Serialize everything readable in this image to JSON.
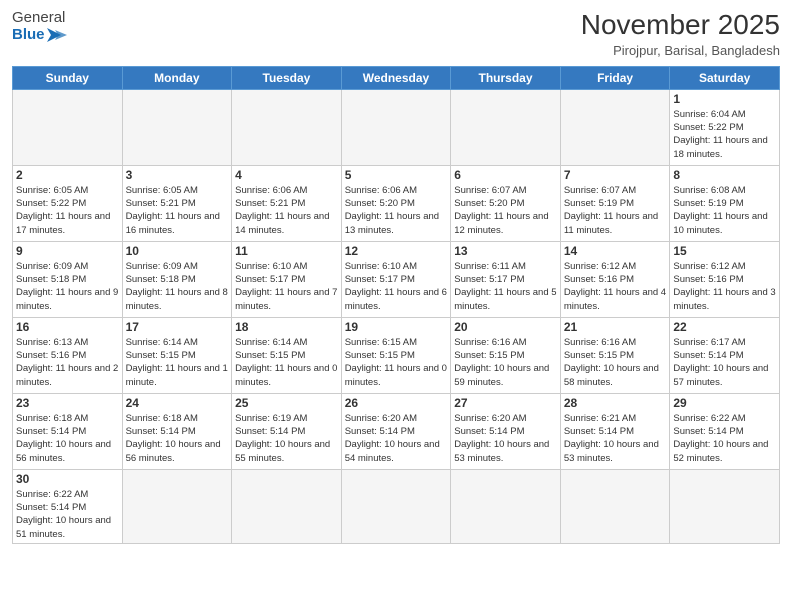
{
  "header": {
    "logo_general": "General",
    "logo_blue": "Blue",
    "month_title": "November 2025",
    "location": "Pirojpur, Barisal, Bangladesh"
  },
  "weekdays": [
    "Sunday",
    "Monday",
    "Tuesday",
    "Wednesday",
    "Thursday",
    "Friday",
    "Saturday"
  ],
  "days": [
    {
      "num": "",
      "info": ""
    },
    {
      "num": "",
      "info": ""
    },
    {
      "num": "",
      "info": ""
    },
    {
      "num": "",
      "info": ""
    },
    {
      "num": "",
      "info": ""
    },
    {
      "num": "",
      "info": ""
    },
    {
      "num": "1",
      "info": "Sunrise: 6:04 AM\nSunset: 5:22 PM\nDaylight: 11 hours and 18 minutes."
    },
    {
      "num": "2",
      "info": "Sunrise: 6:05 AM\nSunset: 5:22 PM\nDaylight: 11 hours and 17 minutes."
    },
    {
      "num": "3",
      "info": "Sunrise: 6:05 AM\nSunset: 5:21 PM\nDaylight: 11 hours and 16 minutes."
    },
    {
      "num": "4",
      "info": "Sunrise: 6:06 AM\nSunset: 5:21 PM\nDaylight: 11 hours and 14 minutes."
    },
    {
      "num": "5",
      "info": "Sunrise: 6:06 AM\nSunset: 5:20 PM\nDaylight: 11 hours and 13 minutes."
    },
    {
      "num": "6",
      "info": "Sunrise: 6:07 AM\nSunset: 5:20 PM\nDaylight: 11 hours and 12 minutes."
    },
    {
      "num": "7",
      "info": "Sunrise: 6:07 AM\nSunset: 5:19 PM\nDaylight: 11 hours and 11 minutes."
    },
    {
      "num": "8",
      "info": "Sunrise: 6:08 AM\nSunset: 5:19 PM\nDaylight: 11 hours and 10 minutes."
    },
    {
      "num": "9",
      "info": "Sunrise: 6:09 AM\nSunset: 5:18 PM\nDaylight: 11 hours and 9 minutes."
    },
    {
      "num": "10",
      "info": "Sunrise: 6:09 AM\nSunset: 5:18 PM\nDaylight: 11 hours and 8 minutes."
    },
    {
      "num": "11",
      "info": "Sunrise: 6:10 AM\nSunset: 5:17 PM\nDaylight: 11 hours and 7 minutes."
    },
    {
      "num": "12",
      "info": "Sunrise: 6:10 AM\nSunset: 5:17 PM\nDaylight: 11 hours and 6 minutes."
    },
    {
      "num": "13",
      "info": "Sunrise: 6:11 AM\nSunset: 5:17 PM\nDaylight: 11 hours and 5 minutes."
    },
    {
      "num": "14",
      "info": "Sunrise: 6:12 AM\nSunset: 5:16 PM\nDaylight: 11 hours and 4 minutes."
    },
    {
      "num": "15",
      "info": "Sunrise: 6:12 AM\nSunset: 5:16 PM\nDaylight: 11 hours and 3 minutes."
    },
    {
      "num": "16",
      "info": "Sunrise: 6:13 AM\nSunset: 5:16 PM\nDaylight: 11 hours and 2 minutes."
    },
    {
      "num": "17",
      "info": "Sunrise: 6:14 AM\nSunset: 5:15 PM\nDaylight: 11 hours and 1 minute."
    },
    {
      "num": "18",
      "info": "Sunrise: 6:14 AM\nSunset: 5:15 PM\nDaylight: 11 hours and 0 minutes."
    },
    {
      "num": "19",
      "info": "Sunrise: 6:15 AM\nSunset: 5:15 PM\nDaylight: 11 hours and 0 minutes."
    },
    {
      "num": "20",
      "info": "Sunrise: 6:16 AM\nSunset: 5:15 PM\nDaylight: 10 hours and 59 minutes."
    },
    {
      "num": "21",
      "info": "Sunrise: 6:16 AM\nSunset: 5:15 PM\nDaylight: 10 hours and 58 minutes."
    },
    {
      "num": "22",
      "info": "Sunrise: 6:17 AM\nSunset: 5:14 PM\nDaylight: 10 hours and 57 minutes."
    },
    {
      "num": "23",
      "info": "Sunrise: 6:18 AM\nSunset: 5:14 PM\nDaylight: 10 hours and 56 minutes."
    },
    {
      "num": "24",
      "info": "Sunrise: 6:18 AM\nSunset: 5:14 PM\nDaylight: 10 hours and 56 minutes."
    },
    {
      "num": "25",
      "info": "Sunrise: 6:19 AM\nSunset: 5:14 PM\nDaylight: 10 hours and 55 minutes."
    },
    {
      "num": "26",
      "info": "Sunrise: 6:20 AM\nSunset: 5:14 PM\nDaylight: 10 hours and 54 minutes."
    },
    {
      "num": "27",
      "info": "Sunrise: 6:20 AM\nSunset: 5:14 PM\nDaylight: 10 hours and 53 minutes."
    },
    {
      "num": "28",
      "info": "Sunrise: 6:21 AM\nSunset: 5:14 PM\nDaylight: 10 hours and 53 minutes."
    },
    {
      "num": "29",
      "info": "Sunrise: 6:22 AM\nSunset: 5:14 PM\nDaylight: 10 hours and 52 minutes."
    },
    {
      "num": "30",
      "info": "Sunrise: 6:22 AM\nSunset: 5:14 PM\nDaylight: 10 hours and 51 minutes."
    },
    {
      "num": "",
      "info": ""
    },
    {
      "num": "",
      "info": ""
    },
    {
      "num": "",
      "info": ""
    },
    {
      "num": "",
      "info": ""
    },
    {
      "num": "",
      "info": ""
    },
    {
      "num": "",
      "info": ""
    }
  ]
}
